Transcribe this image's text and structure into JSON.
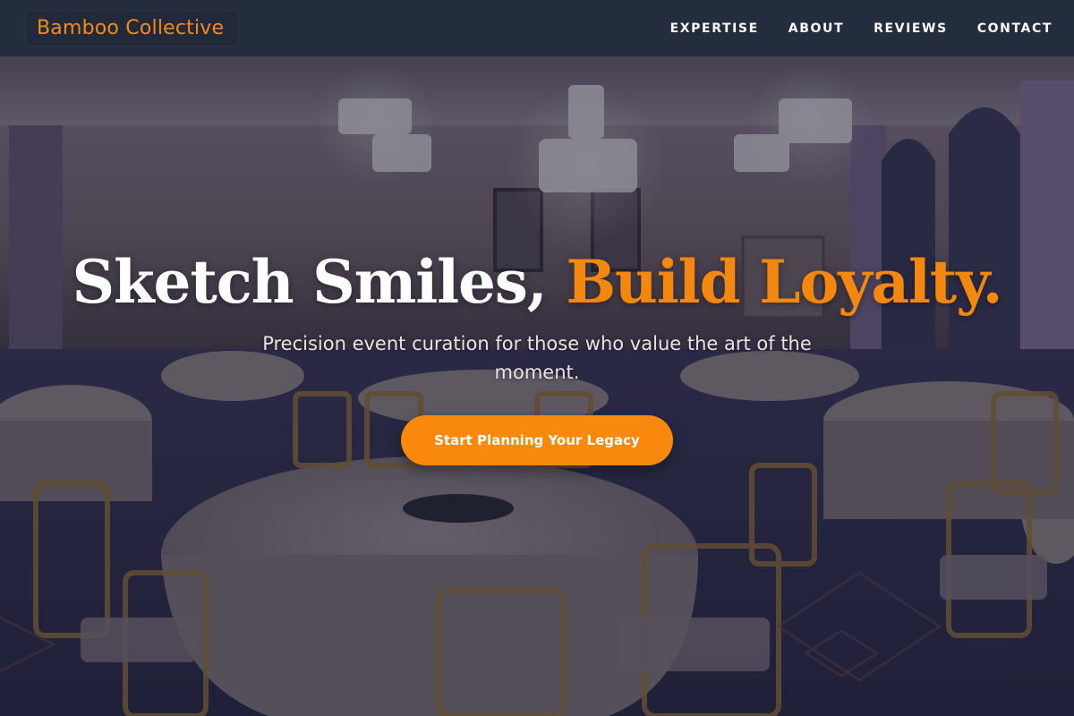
{
  "header": {
    "brand": "Bamboo Collective",
    "nav": [
      {
        "label": "EXPERTISE"
      },
      {
        "label": "ABOUT"
      },
      {
        "label": "REVIEWS"
      },
      {
        "label": "CONTACT"
      }
    ]
  },
  "hero": {
    "title_main": "Sketch Smiles,",
    "title_accent": "Build Loyalty.",
    "subtitle": "Precision event curation for those who value the art of the moment.",
    "cta_label": "Start Planning Your Legacy"
  },
  "colors": {
    "accent": "#f4880f",
    "header_bg": "#242d3e",
    "text_light": "#ffffff"
  },
  "icons": {
    "background": "ballroom-photo"
  }
}
